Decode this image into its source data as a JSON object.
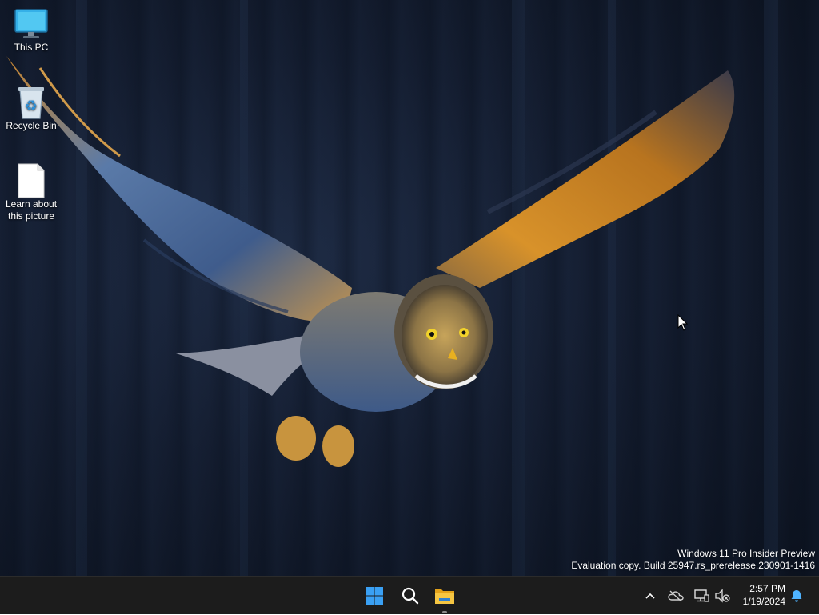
{
  "desktop": {
    "icons": [
      {
        "label": "This PC",
        "icon": "monitor-icon"
      },
      {
        "label": "Recycle Bin",
        "icon": "recycle-bin-icon"
      },
      {
        "label": "Learn about\nthis picture",
        "icon": "document-icon"
      }
    ],
    "watermark": {
      "line1": "Windows 11 Pro Insider Preview",
      "line2": "Evaluation copy. Build 25947.rs_prerelease.230901-1416"
    }
  },
  "taskbar": {
    "pinned": [
      {
        "name": "start",
        "icon": "windows-logo-icon"
      },
      {
        "name": "search",
        "icon": "search-icon"
      },
      {
        "name": "file-explorer",
        "icon": "folder-icon"
      }
    ],
    "tray": {
      "icons": [
        "chevron-up-icon",
        "cloud-offline-icon",
        "network-icon",
        "volume-muted-icon"
      ],
      "time": "2:57 PM",
      "date": "1/19/2024",
      "notification_icon": "bell-icon"
    }
  },
  "colors": {
    "taskbar_bg": "#1c1c1c",
    "windows_blue": "#3aa0f3",
    "folder_yellow": "#f5c542"
  }
}
